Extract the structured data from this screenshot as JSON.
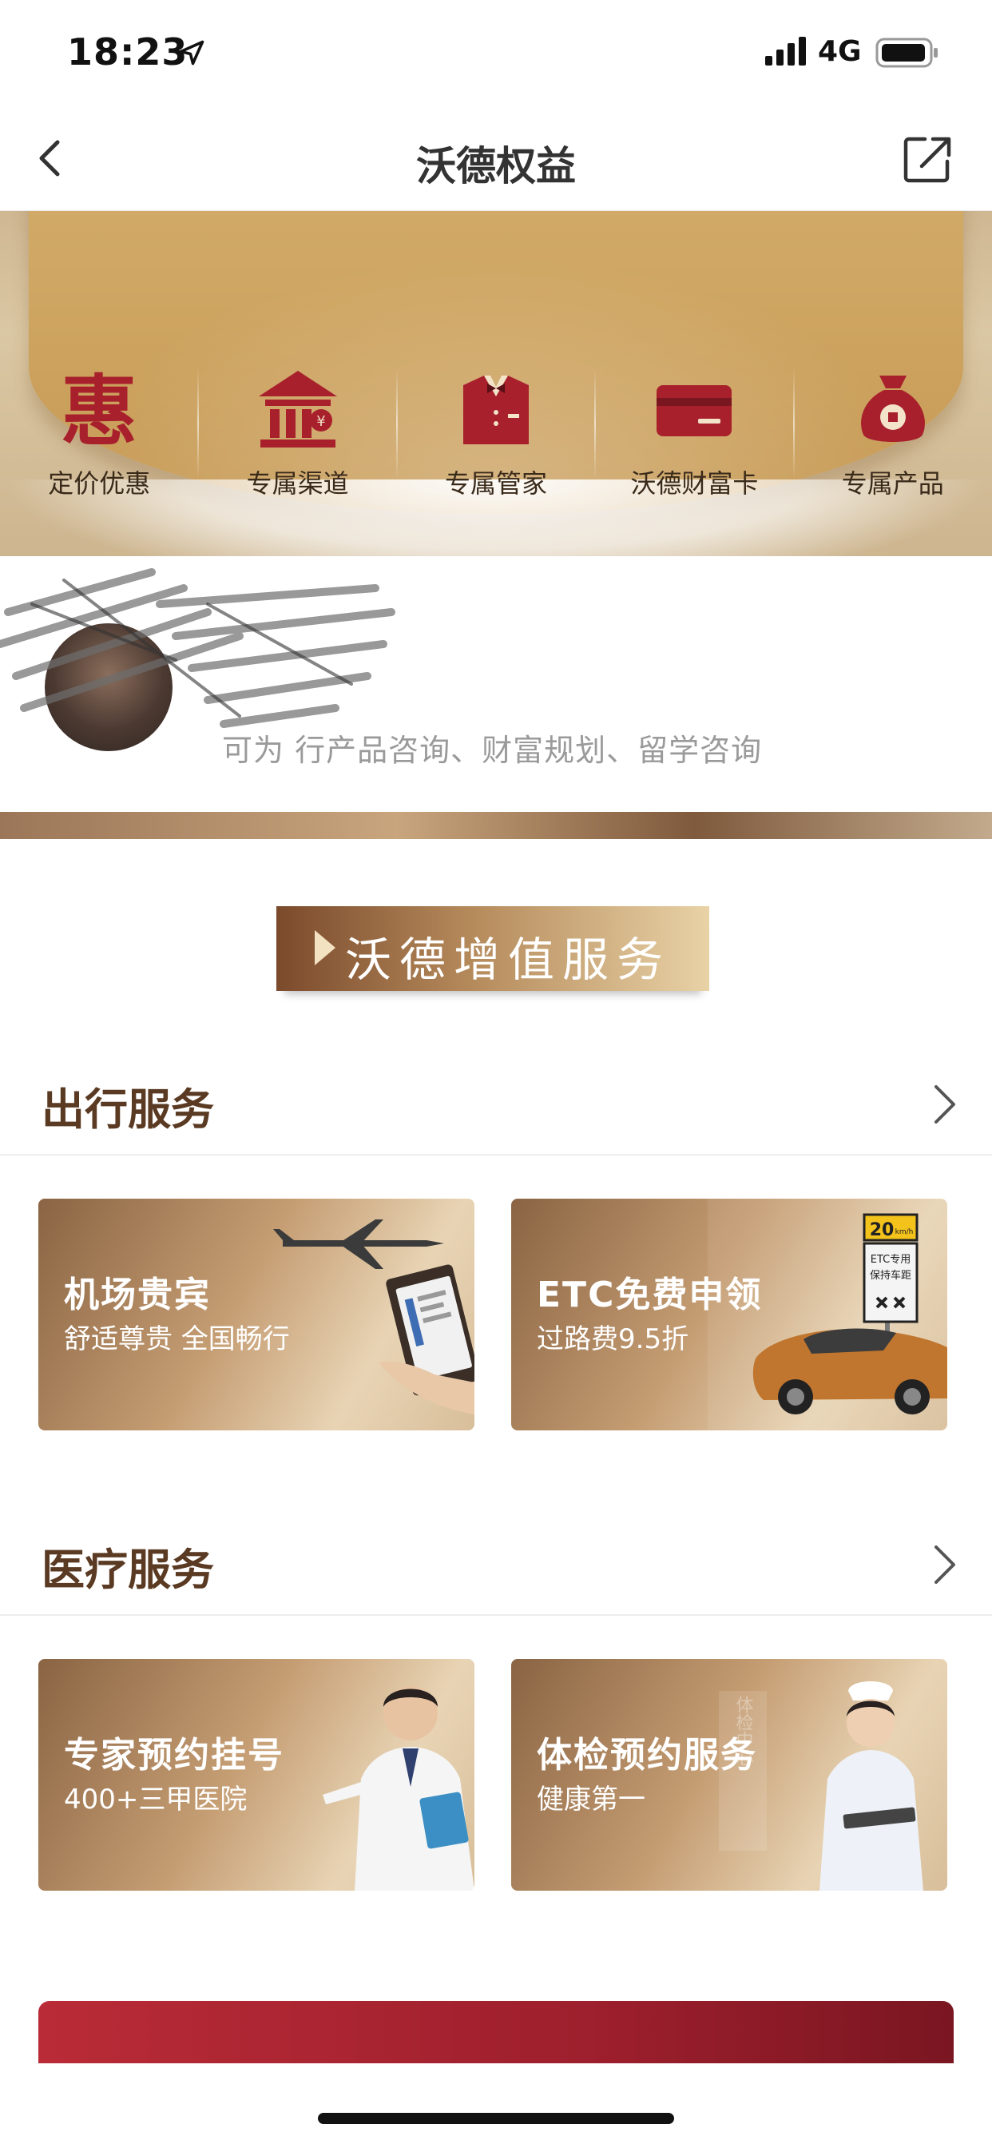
{
  "status": {
    "time": "18:23",
    "network": "4G"
  },
  "nav": {
    "title": "沃德权益"
  },
  "perks": [
    {
      "label": "定价优惠",
      "icon": "hui-character-icon"
    },
    {
      "label": "专属渠道",
      "icon": "bank-icon"
    },
    {
      "label": "专属管家",
      "icon": "butler-suit-icon"
    },
    {
      "label": "沃德财富卡",
      "icon": "card-icon"
    },
    {
      "label": "专属产品",
      "icon": "money-bag-icon"
    }
  ],
  "consultant": {
    "text": "可为      行产品咨询、财富规划、留学咨询"
  },
  "banner": {
    "text": "沃德增值服务"
  },
  "sections": [
    {
      "title": "出行服务",
      "cards": [
        {
          "title": "机场贵宾",
          "subtitle": "舒适尊贵 全国畅行"
        },
        {
          "title": "ETC免费申领",
          "subtitle": "过路费9.5折",
          "sign_top": "20",
          "sign_unit": "km/h",
          "sign_text1": "ETC专用",
          "sign_text2": "保持车距"
        }
      ]
    },
    {
      "title": "医疗服务",
      "cards": [
        {
          "title": "专家预约挂号",
          "subtitle": "400+三甲医院"
        },
        {
          "title": "体检预约服务",
          "subtitle": "健康第一",
          "wall_text": "体检中心"
        }
      ]
    }
  ],
  "colors": {
    "accent_red": "#a8202c",
    "gold": "#c8a57d",
    "section_title": "#5a3a22"
  }
}
